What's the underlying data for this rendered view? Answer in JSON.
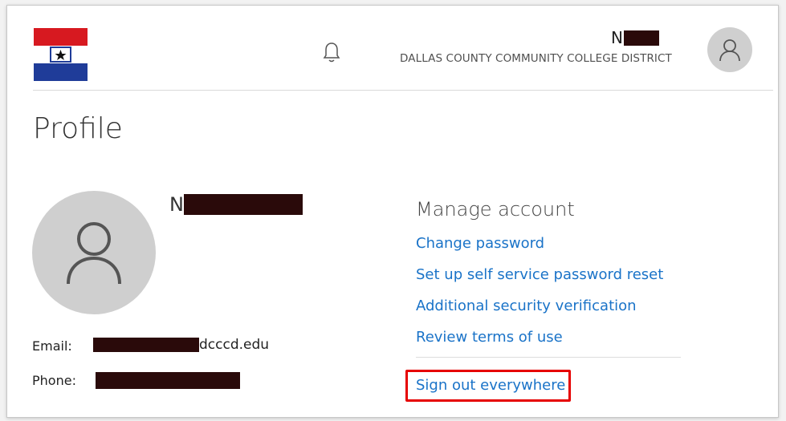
{
  "header": {
    "user_name_initial": "N",
    "organization": "DALLAS COUNTY COMMUNITY COLLEGE DISTRICT"
  },
  "page_title": "Profile",
  "profile": {
    "name_initial": "N",
    "email_label": "Email:",
    "email_suffix": "dcccd.edu",
    "phone_label": "Phone:"
  },
  "manage": {
    "title": "Manage account",
    "links": [
      "Change password",
      "Set up self service password reset",
      "Additional security verification",
      "Review terms of use"
    ],
    "sign_out": "Sign out everywhere"
  },
  "colors": {
    "link": "#1a73c8",
    "highlight_box": "#e60000",
    "avatar_bg": "#cfcfcf",
    "redaction": "#2a0a0a",
    "logo_red": "#d71920",
    "logo_blue": "#1f3c99"
  },
  "icons": {
    "notification": "bell-icon",
    "user_avatar": "person-icon"
  }
}
